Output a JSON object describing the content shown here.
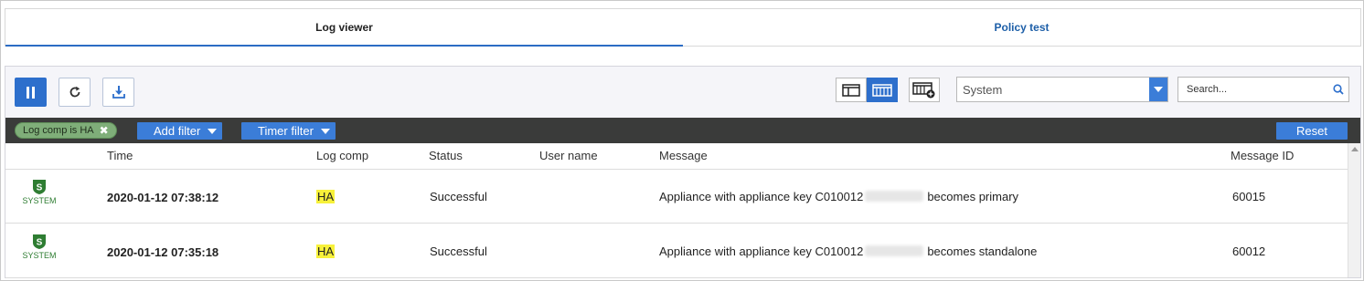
{
  "tabs": [
    {
      "label": "Log viewer",
      "active": true
    },
    {
      "label": "Policy test",
      "active": false
    }
  ],
  "toolbar": {
    "pause_icon": "pause-icon",
    "refresh_icon": "refresh-icon",
    "download_icon": "download-icon",
    "view_icons": [
      "split-view-icon",
      "column-view-icon",
      "add-column-icon"
    ],
    "log_type_select": "System",
    "search_placeholder": "Search..."
  },
  "filters": {
    "chips": [
      {
        "label": "Log comp is HA"
      }
    ],
    "add_filter": "Add filter",
    "timer_filter": "Timer filter",
    "reset": "Reset"
  },
  "table": {
    "headers": {
      "time": "Time",
      "log_comp": "Log comp",
      "status": "Status",
      "user_name": "User name",
      "message": "Message",
      "message_id": "Message ID"
    },
    "rows": [
      {
        "type_label": "SYSTEM",
        "time": "2020-01-12 07:38:12",
        "log_comp": "HA",
        "status": "Successful",
        "user_name": "",
        "message_prefix": "Appliance with appliance key C010012",
        "message_suffix": "becomes primary",
        "message_id": "60015"
      },
      {
        "type_label": "SYSTEM",
        "time": "2020-01-12 07:35:18",
        "log_comp": "HA",
        "status": "Successful",
        "user_name": "",
        "message_prefix": "Appliance with appliance key C010012",
        "message_suffix": "becomes standalone",
        "message_id": "60012"
      }
    ]
  },
  "colors": {
    "accent": "#2d6fcc",
    "filterbar": "#3a3b3a",
    "chip": "#7fae79",
    "highlight": "#f7f13a",
    "system_icon": "#2e7d32"
  }
}
